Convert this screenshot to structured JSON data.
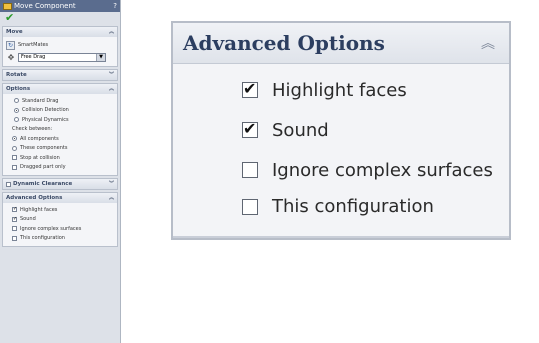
{
  "pm": {
    "title": "Move Component",
    "help": "?",
    "move": {
      "header": "Move",
      "smartmates": "SmartMates",
      "drag_mode": "Free Drag"
    },
    "rotate": {
      "header": "Rotate"
    },
    "options": {
      "header": "Options",
      "standard_drag": "Standard Drag",
      "collision_detection": "Collision Detection",
      "physical_dynamics": "Physical Dynamics",
      "check_between": "Check between:",
      "all_components": "All components",
      "these_components": "These components",
      "stop_at_collision": "Stop at collision",
      "dragged_part_only": "Dragged part only"
    },
    "dynamic_clearance": {
      "header": "Dynamic Clearance"
    },
    "advanced": {
      "header": "Advanced Options",
      "highlight_faces": "Highlight faces",
      "sound": "Sound",
      "ignore_complex_surfaces": "Ignore complex surfaces",
      "this_configuration": "This configuration"
    }
  },
  "zoom": {
    "header": "Advanced Options",
    "highlight_faces": "Highlight faces",
    "sound": "Sound",
    "ignore_complex_surfaces": "Ignore complex surfaces",
    "this_configuration": "This configuration"
  }
}
